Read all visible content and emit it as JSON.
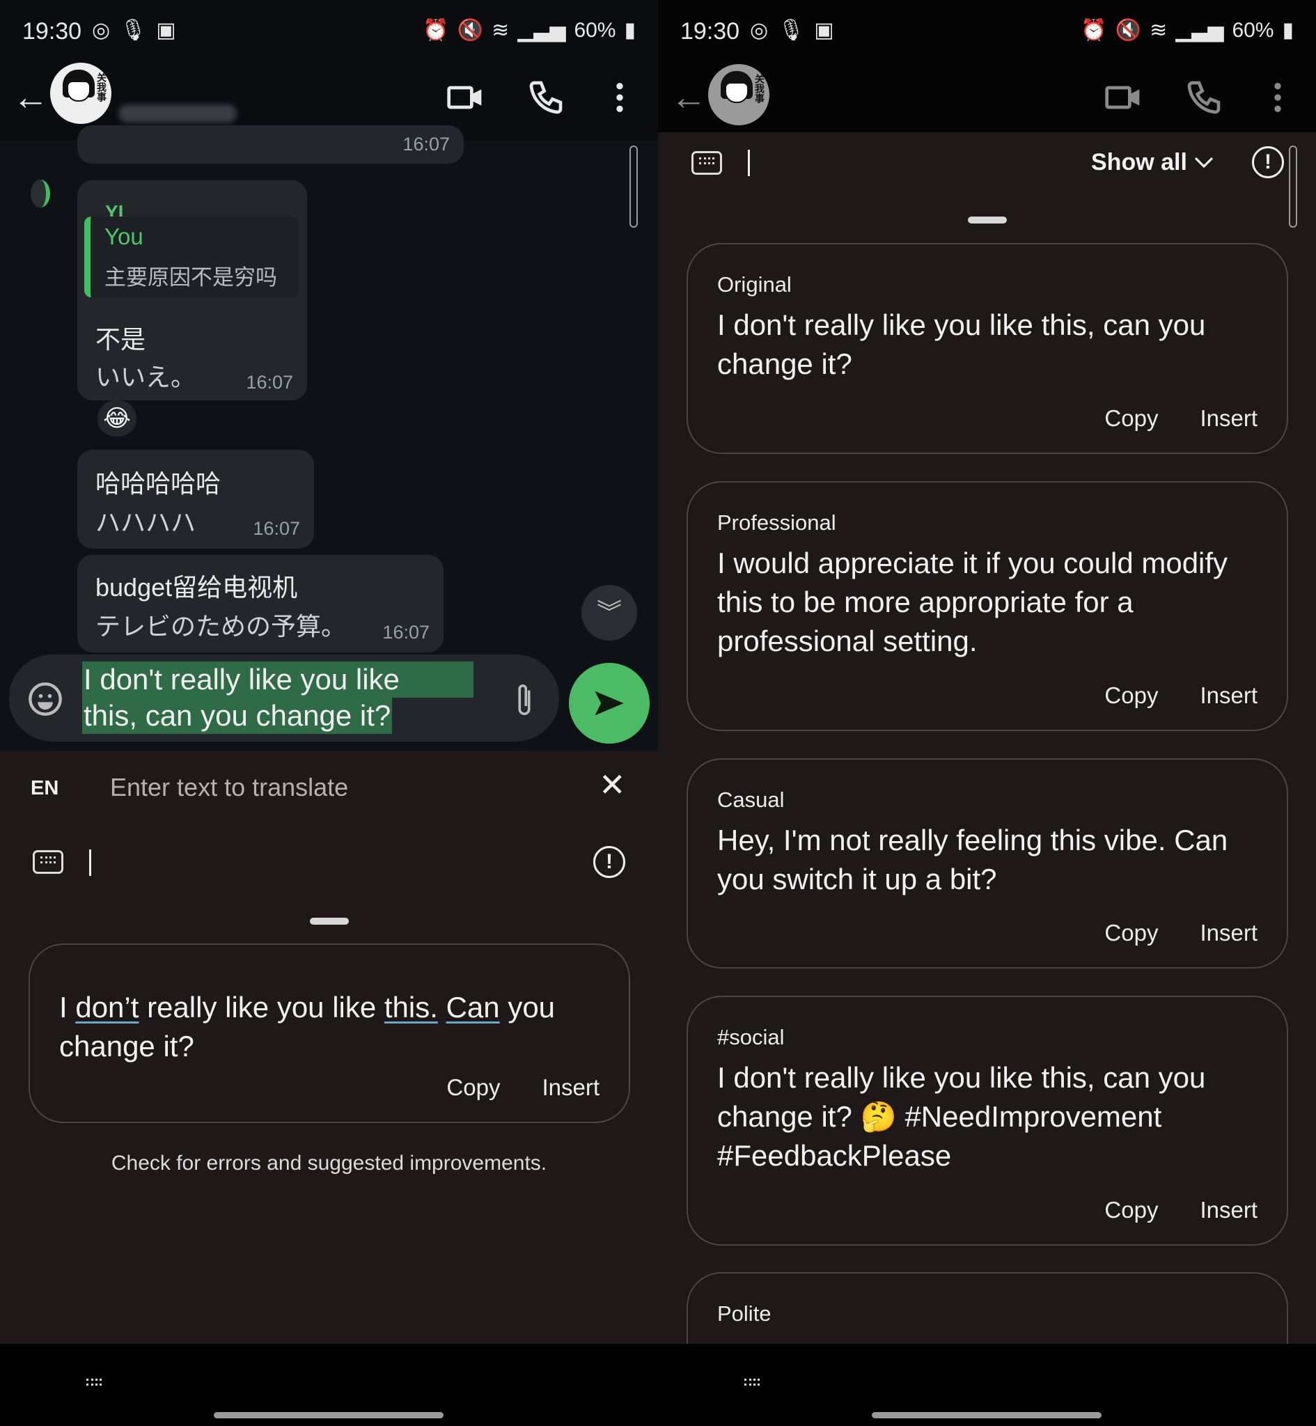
{
  "status": {
    "time": "19:30",
    "battery": "60%"
  },
  "left": {
    "chat": {
      "top_partial_time": "16:07",
      "messages": [
        {
          "quote_sender": "YI",
          "quote_author": "You",
          "quote_text": "主要原因不是穷吗",
          "text": "不是",
          "translation": "いいえ。",
          "time": "16:07",
          "reaction": "😂"
        },
        {
          "text": "哈哈哈哈哈",
          "translation": "ハハハハ",
          "time": "16:07"
        },
        {
          "text": "budget留给电视机",
          "translation": "テレビのための予算。",
          "time": "16:07"
        }
      ],
      "input_line1": "I don't really like you like",
      "input_line2": "this, can you change it?"
    },
    "translate": {
      "lang": "EN",
      "placeholder": "Enter text to translate"
    },
    "suggestion": {
      "segments": [
        {
          "t": "I ",
          "u": false
        },
        {
          "t": "don’t",
          "u": true
        },
        {
          "t": " really like you like ",
          "u": false
        },
        {
          "t": "this.",
          "u": true
        },
        {
          "t": " ",
          "u": false
        },
        {
          "t": "Can",
          "u": true
        },
        {
          "t": " you change it?",
          "u": false
        }
      ],
      "copy": "Copy",
      "insert": "Insert"
    },
    "hint": "Check for errors and suggested improvements."
  },
  "right": {
    "show_all": "Show all",
    "cards": [
      {
        "label": "Original",
        "text": "I don't really like you like this, can you change it?",
        "copy": "Copy",
        "insert": "Insert"
      },
      {
        "label": "Professional",
        "text": "I would appreciate it if you could modify this to be more appropriate for a professional setting.",
        "copy": "Copy",
        "insert": "Insert"
      },
      {
        "label": "Casual",
        "text": "Hey, I'm not really feeling this vibe. Can you switch it up a bit?",
        "copy": "Copy",
        "insert": "Insert"
      },
      {
        "label": "#social",
        "text": "I don't really like you like this, can you change it? 🤔 #NeedImprovement #FeedbackPlease",
        "copy": "Copy",
        "insert": "Insert"
      },
      {
        "label": "Polite"
      }
    ]
  },
  "colors": {
    "accent_green": "#4cbb65",
    "selection": "#2f6b46",
    "sheet_bg": "#1e1819",
    "underline": "#6aa7c9"
  }
}
